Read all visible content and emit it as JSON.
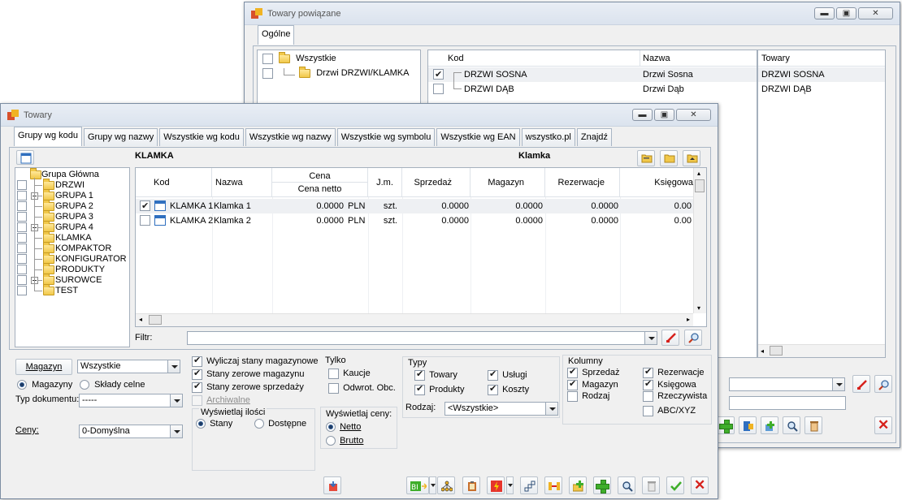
{
  "back_window": {
    "title": "Towary powiązane",
    "tab": "Ogólne",
    "tree": [
      {
        "label": "Wszystkie",
        "checked": false
      },
      {
        "label": "Drzwi  DRZWI/KLAMKA",
        "checked": false
      }
    ],
    "columns": {
      "kod": "Kod",
      "nazwa": "Nazwa",
      "towary": "Towary"
    },
    "rows": [
      {
        "kod": "DRZWI SOSNA",
        "nazwa": "Drzwi Sosna",
        "towary": "DRZWI SOSNA",
        "checked": true
      },
      {
        "kod": "DRZWI DĄB",
        "nazwa": "Drzwi Dąb",
        "towary": "DRZWI DĄB",
        "checked": false
      }
    ]
  },
  "main_window": {
    "title": "Towary",
    "tabs": [
      "Grupy wg kodu",
      "Grupy wg nazwy",
      "Wszystkie wg kodu",
      "Wszystkie wg nazwy",
      "Wszystkie wg symbolu",
      "Wszystkie wg EAN",
      "wszystko.pl",
      "Znajdź"
    ],
    "header": {
      "code": "KLAMKA",
      "name": "Klamka"
    },
    "tree": [
      "Grupa Główna",
      "DRZWI",
      "GRUPA 1",
      "GRUPA 2",
      "GRUPA 3",
      "GRUPA 4",
      "KLAMKA",
      "KOMPAKTOR",
      "KONFIGURATOR",
      "PRODUKTY",
      "SUROWCE",
      "TEST"
    ],
    "columns": {
      "kod": "Kod",
      "nazwa": "Nazwa",
      "cena": "Cena",
      "cena_netto": "Cena netto",
      "jm": "J.m.",
      "sprzedaz": "Sprzedaż",
      "magazyn": "Magazyn",
      "rezerwacje": "Rezerwacje",
      "ksiegowa": "Księgowa"
    },
    "rows": [
      {
        "kod": "KLAMKA 1",
        "nazwa": "Klamka 1",
        "cena": "0.0000",
        "waluta": "PLN",
        "jm": "szt.",
        "sprzedaz": "0.0000",
        "magazyn": "0.0000",
        "rezerwacje": "0.0000",
        "ksiegowa": "0.00",
        "checked": true
      },
      {
        "kod": "KLAMKA 2",
        "nazwa": "Klamka 2",
        "cena": "0.0000",
        "waluta": "PLN",
        "jm": "szt.",
        "sprzedaz": "0.0000",
        "magazyn": "0.0000",
        "rezerwacje": "0.0000",
        "ksiegowa": "0.00",
        "checked": false
      }
    ],
    "filter_label": "Filtr:",
    "filter_value": "",
    "magazyn_button": "Magazyn",
    "magazyn_select": "Wszystkie",
    "radio_magazyny": "Magazyny",
    "radio_sklady": "Składy celne",
    "typ_dokumentu_label": "Typ dokumentu:",
    "typ_dokumentu_value": "-----",
    "ceny_label": "Ceny:",
    "ceny_value": "0-Domyślna",
    "opts": {
      "wyliczaj": "Wyliczaj stany magazynowe",
      "zerowe_mag": "Stany zerowe magazynu",
      "zerowe_sprz": "Stany zerowe sprzedaży",
      "archiwalne": "Archiwalne"
    },
    "wyswietlaj_ilosci": {
      "title": "Wyświetlaj ilości",
      "stany": "Stany",
      "dostepne": "Dostępne"
    },
    "tylko": {
      "title": "Tylko",
      "kaucje": "Kaucje",
      "odwrot": "Odwrot. Obc."
    },
    "wyswietlaj_ceny": {
      "title": "Wyświetlaj ceny:",
      "netto": "Netto",
      "brutto": "Brutto"
    },
    "typy": {
      "title": "Typy",
      "towary": "Towary",
      "uslugi": "Usługi",
      "produkty": "Produkty",
      "koszty": "Koszty"
    },
    "rodzaj_label": "Rodzaj:",
    "rodzaj_value": "<Wszystkie>",
    "kolumny": {
      "title": "Kolumny",
      "sprzedaz": "Sprzedaż",
      "rezerwacje": "Rezerwacje",
      "magazyn": "Magazyn",
      "ksiegowa": "Księgowa",
      "rodzaj": "Rodzaj",
      "rzeczywista": "Rzeczywista",
      "abc": "ABC/XYZ"
    }
  }
}
